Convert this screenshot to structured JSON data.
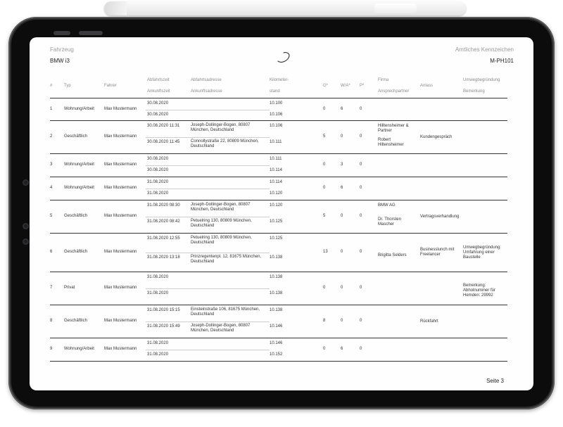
{
  "header": {
    "vehicle_label": "Fahrzeug",
    "vehicle_value": "BMW i3",
    "plate_label": "Amtliches Kennzeichen",
    "plate_value": "M-PH101"
  },
  "table": {
    "headers": {
      "num": "#",
      "typ": "Typ",
      "fahrer": "Fahrer",
      "abfahrtszeit": "Abfahrtszeit",
      "ankunftszeit": "Ankunftszeit",
      "abfahrtsadresse": "Abfahrtsadresse",
      "ankunftsadresse": "Ankunftsadresse",
      "km1": "Kilometer-",
      "km2": "stand",
      "g": "G*",
      "wa": "W/A*",
      "p": "P*",
      "firma": "Firma",
      "ansprechpartner": "Ansprechpartner",
      "anlass": "Anlass",
      "umweg": "Umwegbegründung",
      "bemerkung": "Bemerkung"
    },
    "rows": [
      {
        "num": "1",
        "typ": "Wohnung/Arbeit",
        "fahrer": "Max Mustermann",
        "dep_time": "30.08.2020",
        "arr_time": "30.08.2020",
        "dep_addr": "",
        "arr_addr": "",
        "km_start": "10.100",
        "km_end": "10.106",
        "g": "0",
        "wa": "6",
        "p": "0",
        "firma": "",
        "ansprech": "",
        "anlass": "",
        "note": ""
      },
      {
        "num": "2",
        "typ": "Geschäftlich",
        "fahrer": "Max Mustermann",
        "dep_time": "30.08.2020 11:31",
        "arr_time": "30.08.2020 11:45",
        "dep_addr": "Joseph-Dollinger-Bogen, 80807 München, Deutschland",
        "arr_addr": "Connollystraße 22, 80809 München, Deutschland",
        "km_start": "10.106",
        "km_end": "10.111",
        "g": "5",
        "wa": "0",
        "p": "0",
        "firma": "Hilltensheimer & Partner",
        "ansprech": "Robert Hiltensheimer",
        "anlass": "Kundengespräch",
        "note": ""
      },
      {
        "num": "3",
        "typ": "Wohnung/Arbeit",
        "fahrer": "Max Mustermann",
        "dep_time": "30.08.2020",
        "arr_time": "30.08.2020",
        "dep_addr": "",
        "arr_addr": "",
        "km_start": "10.111",
        "km_end": "10.114",
        "g": "0",
        "wa": "3",
        "p": "0",
        "firma": "",
        "ansprech": "",
        "anlass": "",
        "note": ""
      },
      {
        "num": "4",
        "typ": "Wohnung/Arbeit",
        "fahrer": "Max Mustermann",
        "dep_time": "31.08.2020",
        "arr_time": "31.08.2020",
        "dep_addr": "",
        "arr_addr": "",
        "km_start": "10.114",
        "km_end": "10.120",
        "g": "0",
        "wa": "6",
        "p": "0",
        "firma": "",
        "ansprech": "",
        "anlass": "",
        "note": ""
      },
      {
        "num": "5",
        "typ": "Geschäftlich",
        "fahrer": "Max Mustermann",
        "dep_time": "31.08.2020 08:30",
        "arr_time": "31.08.2020 08:42",
        "dep_addr": "Joseph-Dollinger-Bogen, 80807 München, Deutschland",
        "arr_addr": "Petuelring 130, 80809 München, Deutschland",
        "km_start": "10.120",
        "km_end": "10.125",
        "g": "5",
        "wa": "0",
        "p": "0",
        "firma": "BMW AG",
        "ansprech": "Dr. Thorsten Mascher",
        "anlass": "Vertragsverhandlung",
        "note": ""
      },
      {
        "num": "6",
        "typ": "Geschäftlich",
        "fahrer": "Max Mustermann",
        "dep_time": "31.08.2020 12:55",
        "arr_time": "31.08.2020 13:18",
        "dep_addr": "Petuelring 130, 80809 München, Deutschland",
        "arr_addr": "Prinzregentenpl. 12, 81675 München, Deutschland",
        "km_start": "10.125",
        "km_end": "10.138",
        "g": "13",
        "wa": "0",
        "p": "0",
        "firma": "",
        "ansprech": "Brigitta Selders",
        "anlass": "Businesslunch mit Freelancer",
        "note": "Umwegbegründung: Umfahrung einer Baustelle"
      },
      {
        "num": "7",
        "typ": "Privat",
        "fahrer": "Max Mustermann",
        "dep_time": "31.08.2020",
        "arr_time": "31.08.2020",
        "dep_addr": "",
        "arr_addr": "",
        "km_start": "10.138",
        "km_end": "10.138",
        "g": "0",
        "wa": "0",
        "p": "0",
        "firma": "",
        "ansprech": "",
        "anlass": "",
        "note": "Bemerkung: Abholnummer für Hemden: 29992"
      },
      {
        "num": "8",
        "typ": "Geschäftlich",
        "fahrer": "Max Mustermann",
        "dep_time": "31.08.2020 15:15",
        "arr_time": "31.08.2020 15:49",
        "dep_addr": "Einsteinstraße 106, 81675 München, Deutschland",
        "arr_addr": "Joseph-Dollinger-Bogen, 80807 München, Deutschland",
        "km_start": "10.138",
        "km_end": "10.146",
        "g": "8",
        "wa": "0",
        "p": "0",
        "firma": "",
        "ansprech": "",
        "anlass": "Rückfahrt",
        "note": ""
      },
      {
        "num": "9",
        "typ": "Wohnung/Arbeit",
        "fahrer": "Max Mustermann",
        "dep_time": "31.08.2020",
        "arr_time": "31.08.2020",
        "dep_addr": "",
        "arr_addr": "",
        "km_start": "10.146",
        "km_end": "10.152",
        "g": "0",
        "wa": "6",
        "p": "0",
        "firma": "",
        "ansprech": "",
        "anlass": "",
        "note": ""
      }
    ]
  },
  "footer": {
    "page": "Seite 3"
  }
}
